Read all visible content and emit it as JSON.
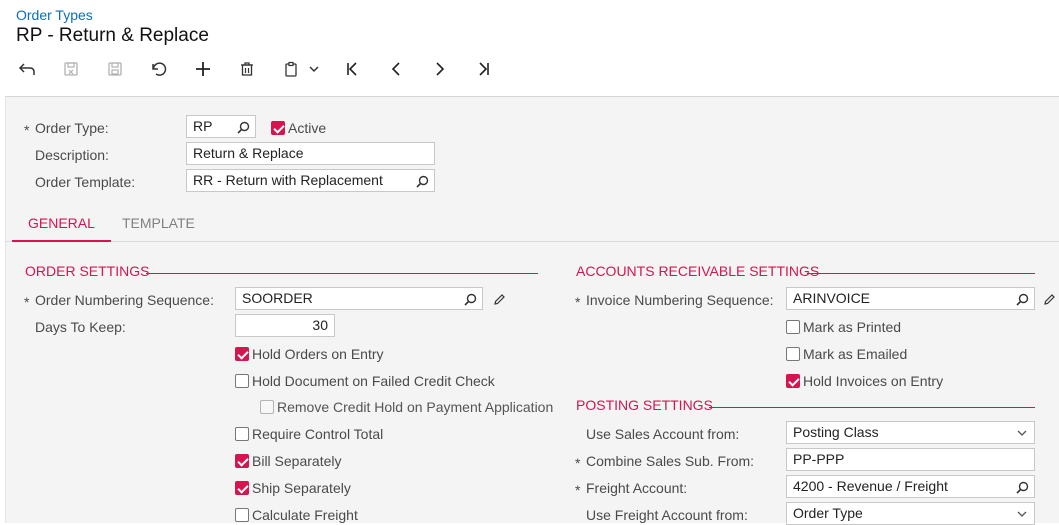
{
  "header": {
    "breadcrumb": "Order Types",
    "title": "RP - Return & Replace"
  },
  "toolbar": {
    "icons": [
      "back-arrow-icon",
      "save-close-icon",
      "save-icon",
      "undo-icon",
      "add-icon",
      "delete-icon",
      "copy-paste-icon",
      "chevron-down-icon",
      "first-record-icon",
      "previous-record-icon",
      "next-record-icon",
      "last-record-icon"
    ]
  },
  "form": {
    "order_type": {
      "label": "Order Type:",
      "value": "RP",
      "required_mark": "*"
    },
    "active": {
      "label": "Active",
      "checked": true
    },
    "description": {
      "label": "Description:",
      "value": "Return & Replace"
    },
    "order_template": {
      "label": "Order Template:",
      "value": "RR - Return with Replacement"
    }
  },
  "tabs": [
    {
      "label": "GENERAL",
      "active": true
    },
    {
      "label": "TEMPLATE",
      "active": false
    }
  ],
  "order_settings": {
    "title": "ORDER SETTINGS",
    "numbering_sequence": {
      "label": "Order Numbering Sequence:",
      "value": "SOORDER",
      "required_mark": "*"
    },
    "days_to_keep": {
      "label": "Days To Keep:",
      "value": "30"
    },
    "checkboxes": [
      {
        "label": "Hold Orders on Entry",
        "checked": true
      },
      {
        "label": "Hold Document on Failed Credit Check",
        "checked": false
      },
      {
        "label": "Remove Credit Hold on Payment Application",
        "checked": false,
        "disabled": true
      },
      {
        "label": "Require Control Total",
        "checked": false
      },
      {
        "label": "Bill Separately",
        "checked": true
      },
      {
        "label": "Ship Separately",
        "checked": true
      },
      {
        "label": "Calculate Freight",
        "checked": false
      }
    ]
  },
  "ar_settings": {
    "title": "ACCOUNTS RECEIVABLE SETTINGS",
    "invoice_sequence": {
      "label": "Invoice Numbering Sequence:",
      "value": "ARINVOICE",
      "required_mark": "*"
    },
    "checkboxes": [
      {
        "label": "Mark as Printed",
        "checked": false
      },
      {
        "label": "Mark as Emailed",
        "checked": false
      },
      {
        "label": "Hold Invoices on Entry",
        "checked": true
      }
    ]
  },
  "posting_settings": {
    "title": "POSTING SETTINGS",
    "use_sales_account": {
      "label": "Use Sales Account from:",
      "value": "Posting Class"
    },
    "combine_sales_sub": {
      "label": "Combine Sales Sub. From:",
      "value": "PP-PPP",
      "required_mark": "*"
    },
    "freight_account": {
      "label": "Freight Account:",
      "value": "4200 - Revenue / Freight",
      "required_mark": "*"
    },
    "use_freight_account": {
      "label": "Use Freight Account from:",
      "value": "Order Type"
    }
  },
  "colors": {
    "accent": "#d5154f",
    "link": "#0a6ebd",
    "panel_bg": "#f4f4f4"
  }
}
